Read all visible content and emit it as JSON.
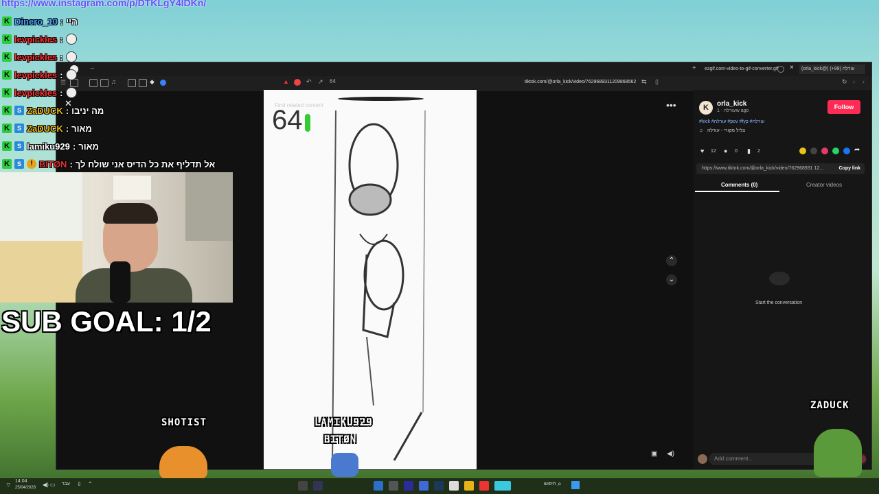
{
  "overlay": {
    "top_url": "https://www.instagram.com/p/DTKLgY4lDKn/",
    "sub_goal": "SUB GOAL: 1/2",
    "shotist": "SHOTIST",
    "video_names": [
      "LAMIKU929",
      "BITØN"
    ],
    "zaduck": "ZADUCK"
  },
  "chat": [
    {
      "name": "Dinero_10",
      "msg": "היי",
      "color": "#4aa3ff"
    },
    {
      "name": "levpickles",
      "msg": "",
      "color": "#ff3030"
    },
    {
      "name": "levpickles",
      "msg": "",
      "color": "#ff3030"
    },
    {
      "name": "levpickles",
      "msg": "",
      "color": "#ff3030"
    },
    {
      "name": "levpickles",
      "msg": "",
      "color": "#ff3030"
    },
    {
      "name": "ZaDUCK",
      "msg": "מה יניבו",
      "color": "#e8b318"
    },
    {
      "name": "ZaDUCK",
      "msg": "מאור",
      "color": "#e8b318"
    },
    {
      "name": "lamiku929",
      "msg": "מאור",
      "color": "#ffffff"
    },
    {
      "name": "BITØN",
      "msg": "אל תדליף את כל הדיס אני שולח לך",
      "color": "#d33"
    }
  ],
  "browser": {
    "tabs": [
      "ezgif.com-video-to-gif-converter.gif",
      "(orla_kick@) עורלה (99+)"
    ],
    "url": "tiktok.com/@orla_kick/video/7629689311209868562"
  },
  "video": {
    "score": "64",
    "watermark": "Find related content"
  },
  "tiktok": {
    "username": "orla_kick",
    "sub": "עורלה · 1w ago",
    "hashtags": "#kick #עורלה #pov #fyp #עורלה",
    "sound": "צליל מקורי - עורלה",
    "likes": "12",
    "comments": "0",
    "saves": "2",
    "link": "https://www.tiktok.com/@orla_kick/video/762968931 12...",
    "copy_link": "Copy link",
    "follow": "Follow",
    "tab_comments": "Comments (0)",
    "tab_creator": "Creator videos",
    "start_convo": "Start the conversation",
    "add_comment": "Add comment..."
  },
  "taskbar": {
    "time": "14:04",
    "date": "25/04/2026",
    "search": "חיפוש",
    "lang": "עבר"
  },
  "colors": {
    "follow": "#fe2c55",
    "panel_bg": "#161616",
    "browser_bg": "#111111"
  }
}
